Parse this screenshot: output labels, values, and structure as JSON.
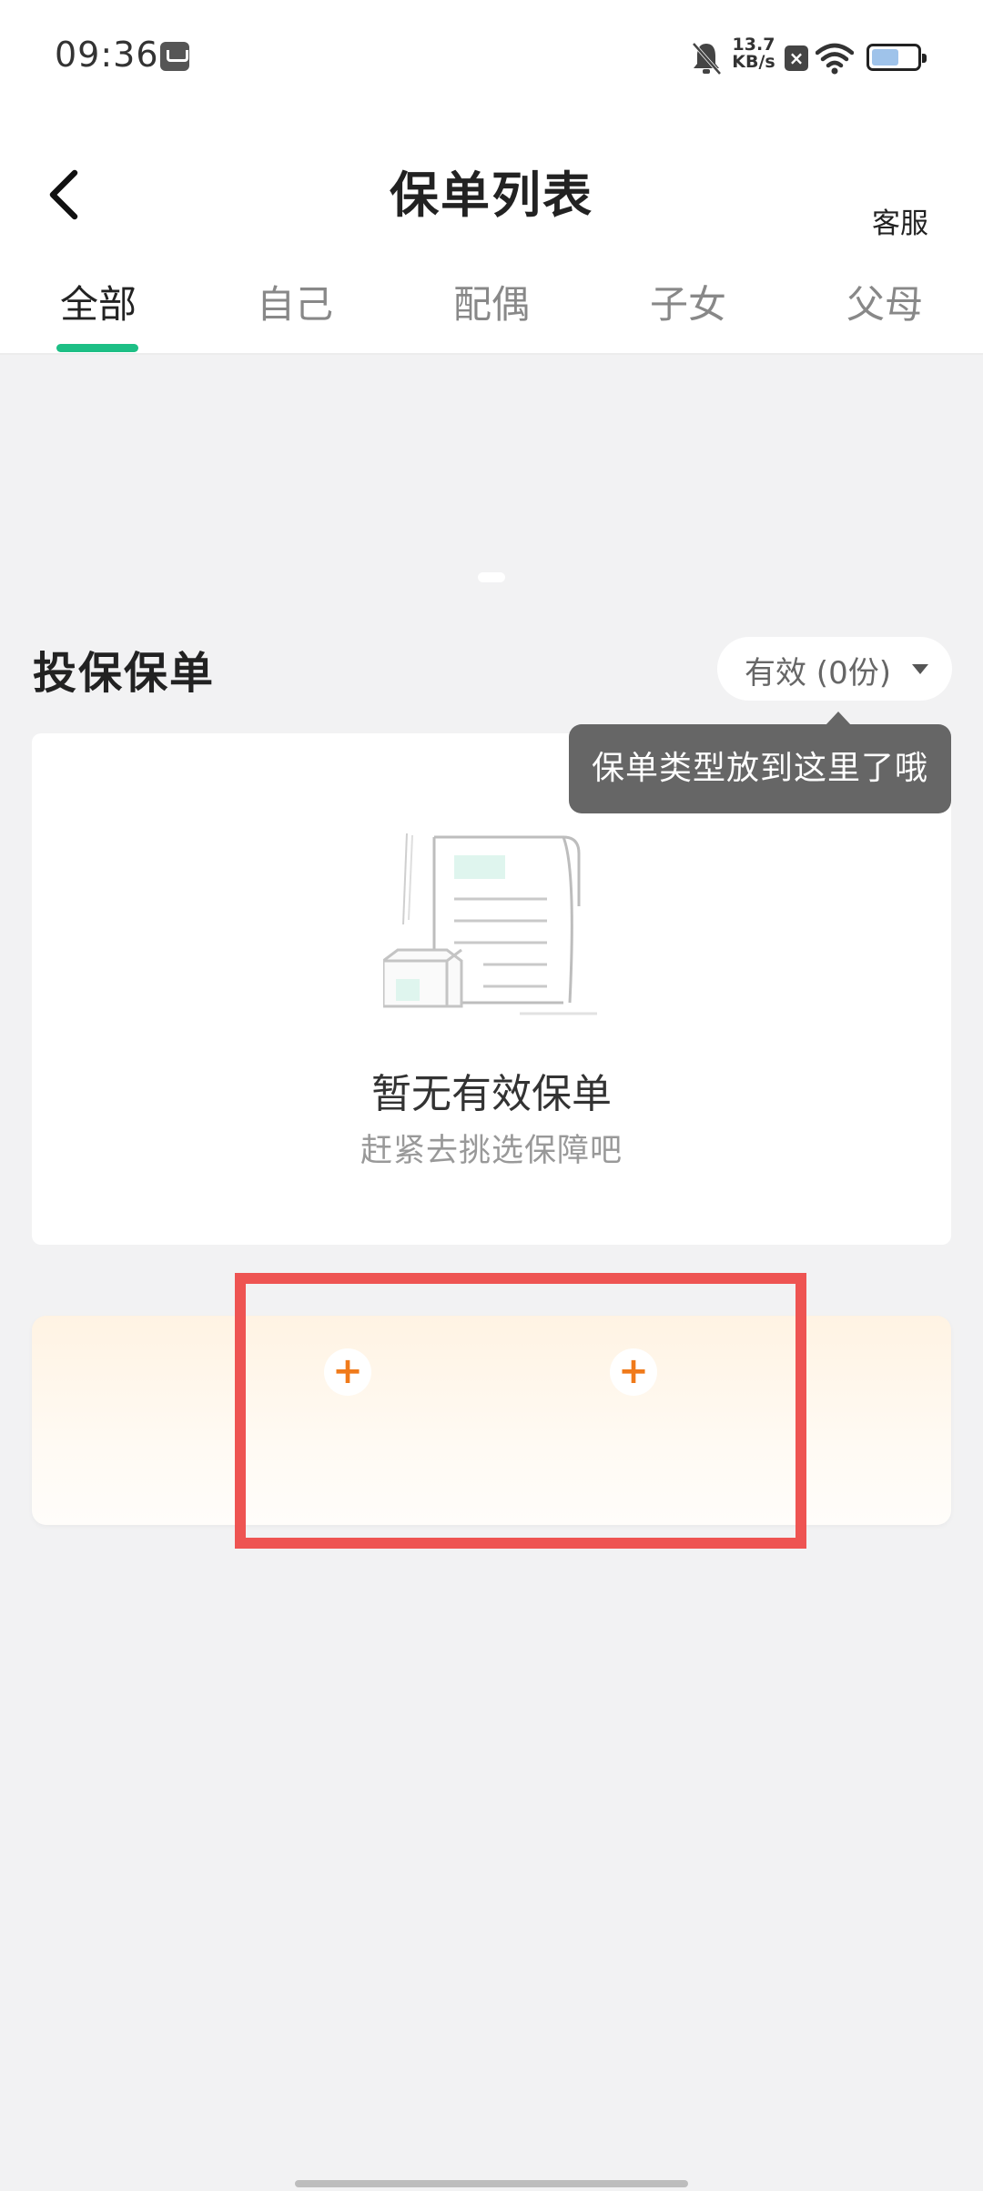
{
  "status_bar": {
    "time": "09:36",
    "network_speed_value": "13.7",
    "network_speed_unit": "KB/s",
    "battery_level": 0.6,
    "icons": [
      "box-icon",
      "mute-bell-icon",
      "sim-x-icon",
      "wifi-icon",
      "battery-icon"
    ]
  },
  "header": {
    "title": "保单列表",
    "service_label": "客服"
  },
  "tabs": [
    {
      "label": "全部",
      "active": true
    },
    {
      "label": "自己",
      "active": false
    },
    {
      "label": "配偶",
      "active": false
    },
    {
      "label": "子女",
      "active": false
    },
    {
      "label": "父母",
      "active": false
    }
  ],
  "policy_section": {
    "title": "投保保单",
    "filter_label": "有效 (0份)",
    "tooltip": "保单类型放到这里了哦",
    "empty_title": "暂无有效保单",
    "empty_subtitle": "赶紧去挑选保障吧"
  },
  "add_card": {
    "button_icon": "plus-icon",
    "button_count": 2
  },
  "colors": {
    "accent_green": "#1dbf85",
    "add_orange": "#f07a1a",
    "highlight_red": "#ee5452",
    "tooltip_bg": "#666666"
  }
}
